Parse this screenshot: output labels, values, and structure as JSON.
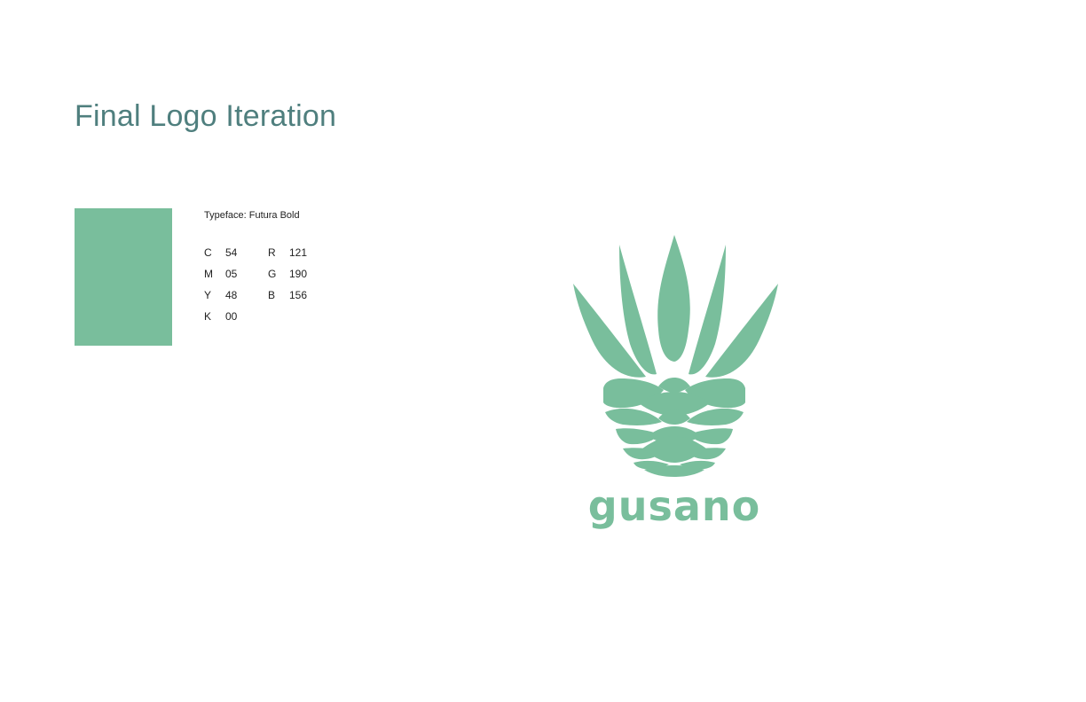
{
  "header": {
    "title": "Final Logo Iteration"
  },
  "swatch": {
    "color": "#79be9c"
  },
  "spec": {
    "typeface_label": "Typeface: Futura Bold",
    "rows": [
      {
        "cmyk_letter": "C",
        "cmyk_value": "54",
        "rgb_letter": "R",
        "rgb_value": "121"
      },
      {
        "cmyk_letter": "M",
        "cmyk_value": "05",
        "rgb_letter": "G",
        "rgb_value": "190"
      },
      {
        "cmyk_letter": "Y",
        "cmyk_value": "48",
        "rgb_letter": "B",
        "rgb_value": "156"
      },
      {
        "cmyk_letter": "K",
        "cmyk_value": "00",
        "rgb_letter": "",
        "rgb_value": ""
      }
    ]
  },
  "logo": {
    "wordmark": "gusano",
    "color": "#79be9c",
    "icon": "agave-pina-icon"
  }
}
